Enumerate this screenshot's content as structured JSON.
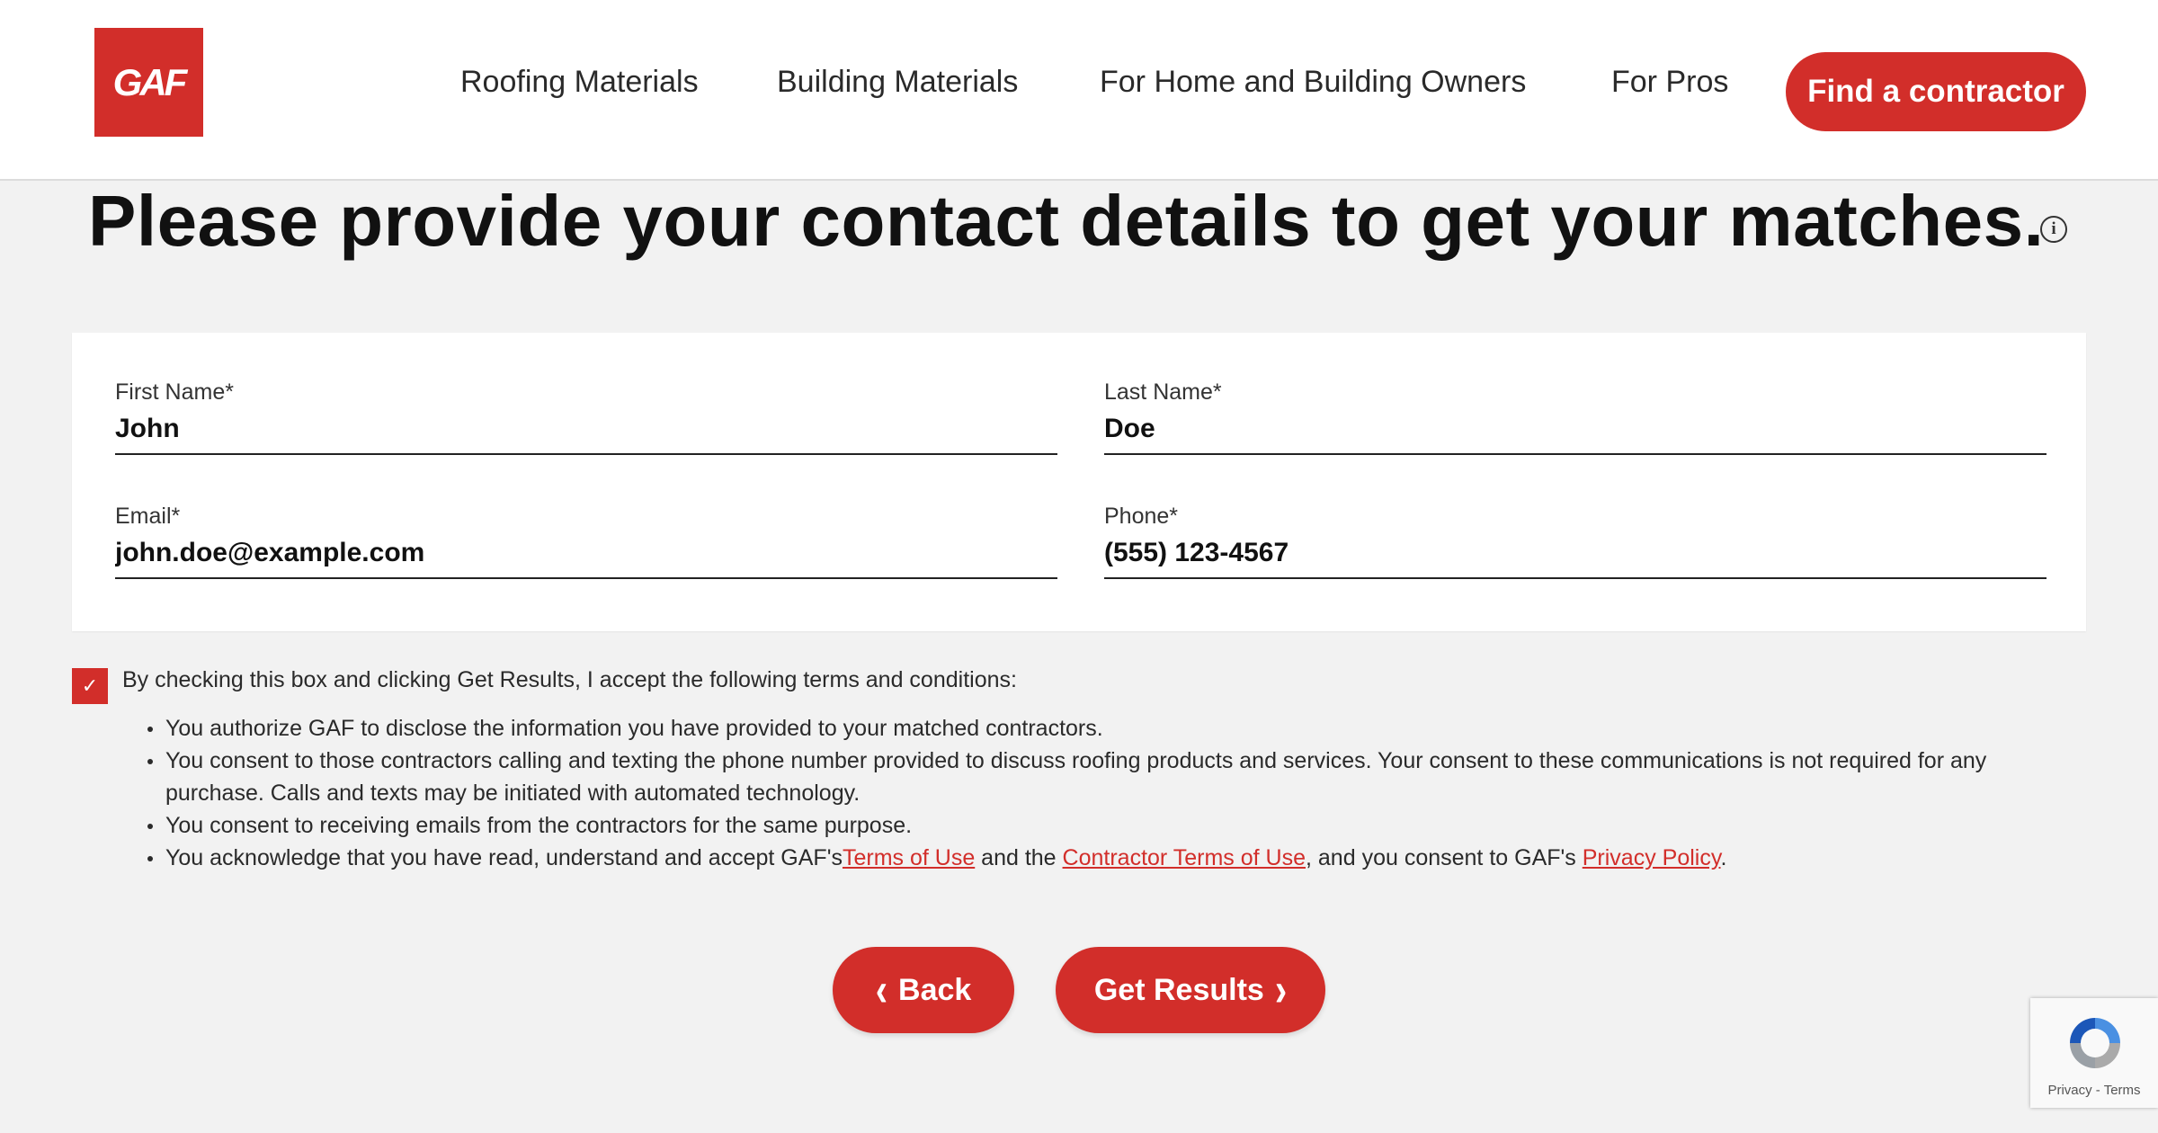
{
  "header": {
    "logo_text": "GAF",
    "nav": [
      {
        "label": "Roofing Materials"
      },
      {
        "label": "Building Materials"
      },
      {
        "label": "For Home and Building Owners"
      },
      {
        "label": "For Pros"
      }
    ],
    "cta_label": "Find a contractor"
  },
  "page": {
    "title": "Please provide your contact details to get your matches.",
    "info_icon_glyph": "i"
  },
  "form": {
    "first_name": {
      "label": "First Name*",
      "value": "John"
    },
    "last_name": {
      "label": "Last Name*",
      "value": "Doe"
    },
    "email": {
      "label": "Email*",
      "value": "john.doe@example.com"
    },
    "phone": {
      "label": "Phone*",
      "value": "(555) 123-4567"
    }
  },
  "consent": {
    "checked": true,
    "intro": "By checking this box and clicking Get Results, I accept the following terms and conditions:",
    "item1": "You authorize GAF to disclose the information you have provided to your matched contractors.",
    "item2": "You consent to those contractors calling and texting the phone number provided to discuss roofing products and services. Your consent to these communications is not required for any purchase. Calls and texts may be initiated with automated technology.",
    "item3": "You consent to receiving emails from the contractors for the same purpose.",
    "item4": {
      "part1": "You acknowledge that you have read, understand and accept GAF's",
      "link1": "Terms of Use",
      "part2": " and the ",
      "link2": "Contractor Terms of Use",
      "part3": ", and you consent to GAF's ",
      "link3": "Privacy Policy",
      "part4": "."
    }
  },
  "actions": {
    "back_label": "Back",
    "submit_label": "Get Results"
  },
  "recaptcha": {
    "privacy": "Privacy",
    "separator": " - ",
    "terms": "Terms"
  },
  "colors": {
    "brand_red": "#d22e2a",
    "background": "#f2f2f2"
  }
}
